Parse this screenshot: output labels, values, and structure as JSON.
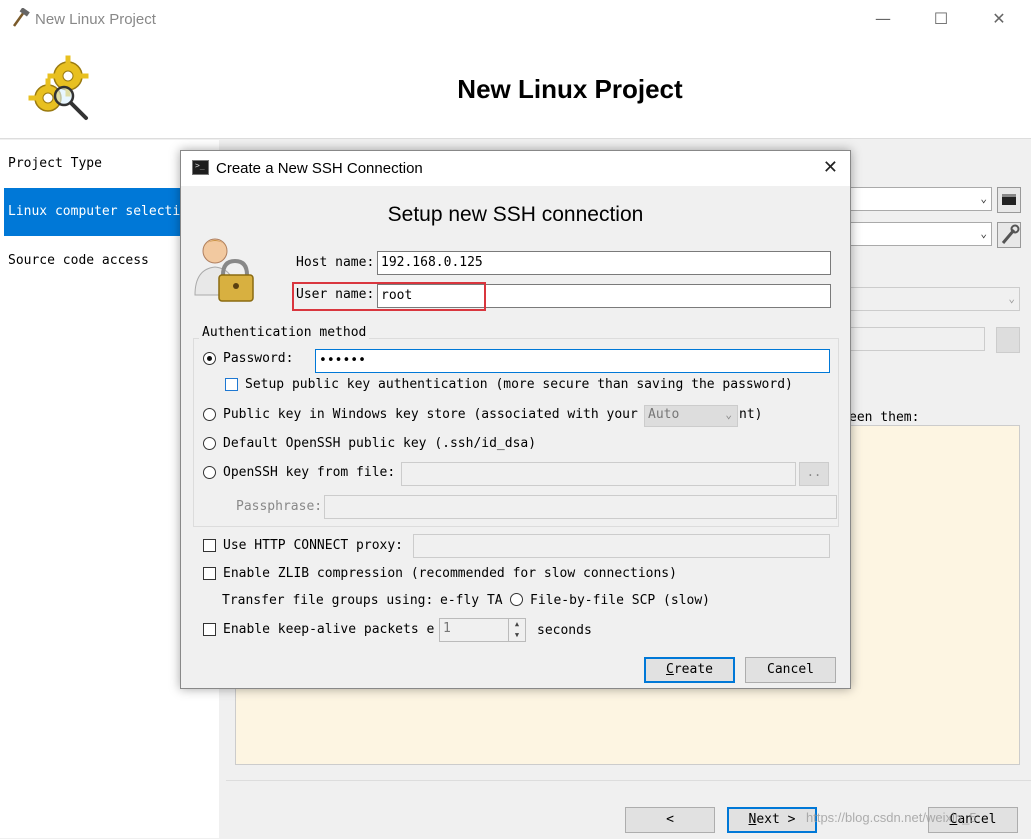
{
  "window": {
    "title": "New Linux Project",
    "header_title": "New Linux Project",
    "minimize": "—",
    "maximize": "☐",
    "close": "✕"
  },
  "left_nav": {
    "items": [
      {
        "label": "Project Type",
        "selected": false
      },
      {
        "label": "Linux computer selection",
        "selected": true
      },
      {
        "label": "Source code access",
        "selected": false
      }
    ]
  },
  "background": {
    "partial_label": "een them:"
  },
  "wizard_buttons": {
    "back": "<",
    "next_key": "N",
    "next_rest": "ext >",
    "cancel_key": "C",
    "cancel_rest": "ancel"
  },
  "watermark": "https://blog.csdn.net/weixin_5",
  "dialog": {
    "title": "Create a New SSH Connection",
    "heading": "Setup new SSH connection",
    "host_name_label": "Host name:",
    "host_name_value": "192.168.0.125",
    "user_name_label": "User name:",
    "user_name_value": "root",
    "auth_group_title": "Authentication method",
    "password_label": "Password:",
    "password_value": "••••••",
    "setup_pubkey_label": "Setup public key authentication (more secure than saving the password)",
    "pubkey_windows_label": "Public key in Windows key store (associated with your",
    "pubkey_windows_suffix": "nt)",
    "key_store_combo": "Auto",
    "default_openssh_label": "Default OpenSSH public key (.ssh/id_dsa)",
    "openssh_file_label": "OpenSSH key from file:",
    "browse_button": "..",
    "passphrase_label": "Passphrase:",
    "proxy_label": "Use HTTP CONNECT proxy:",
    "zlib_label": "Enable ZLIB compression (recommended for slow connections)",
    "transfer_label": "Transfer file groups using:",
    "transfer_option1": "e-fly TA",
    "transfer_option2": "File-by-file SCP (slow)",
    "keepalive_label": "Enable keep-alive packets e",
    "keepalive_value": "1",
    "keepalive_unit": "seconds",
    "create_key": "C",
    "create_rest": "reate",
    "cancel": "Cancel",
    "close": "✕"
  },
  "colors": {
    "selection": "#0078d7",
    "highlight_box": "#d9363e",
    "text_area": "#fdf5e2"
  },
  "icons": [
    "app-hammer-icon",
    "gears-magnifier-icon",
    "terminal-icon",
    "user-lock-icon",
    "terminal-button-icon",
    "wrench-button-icon"
  ]
}
